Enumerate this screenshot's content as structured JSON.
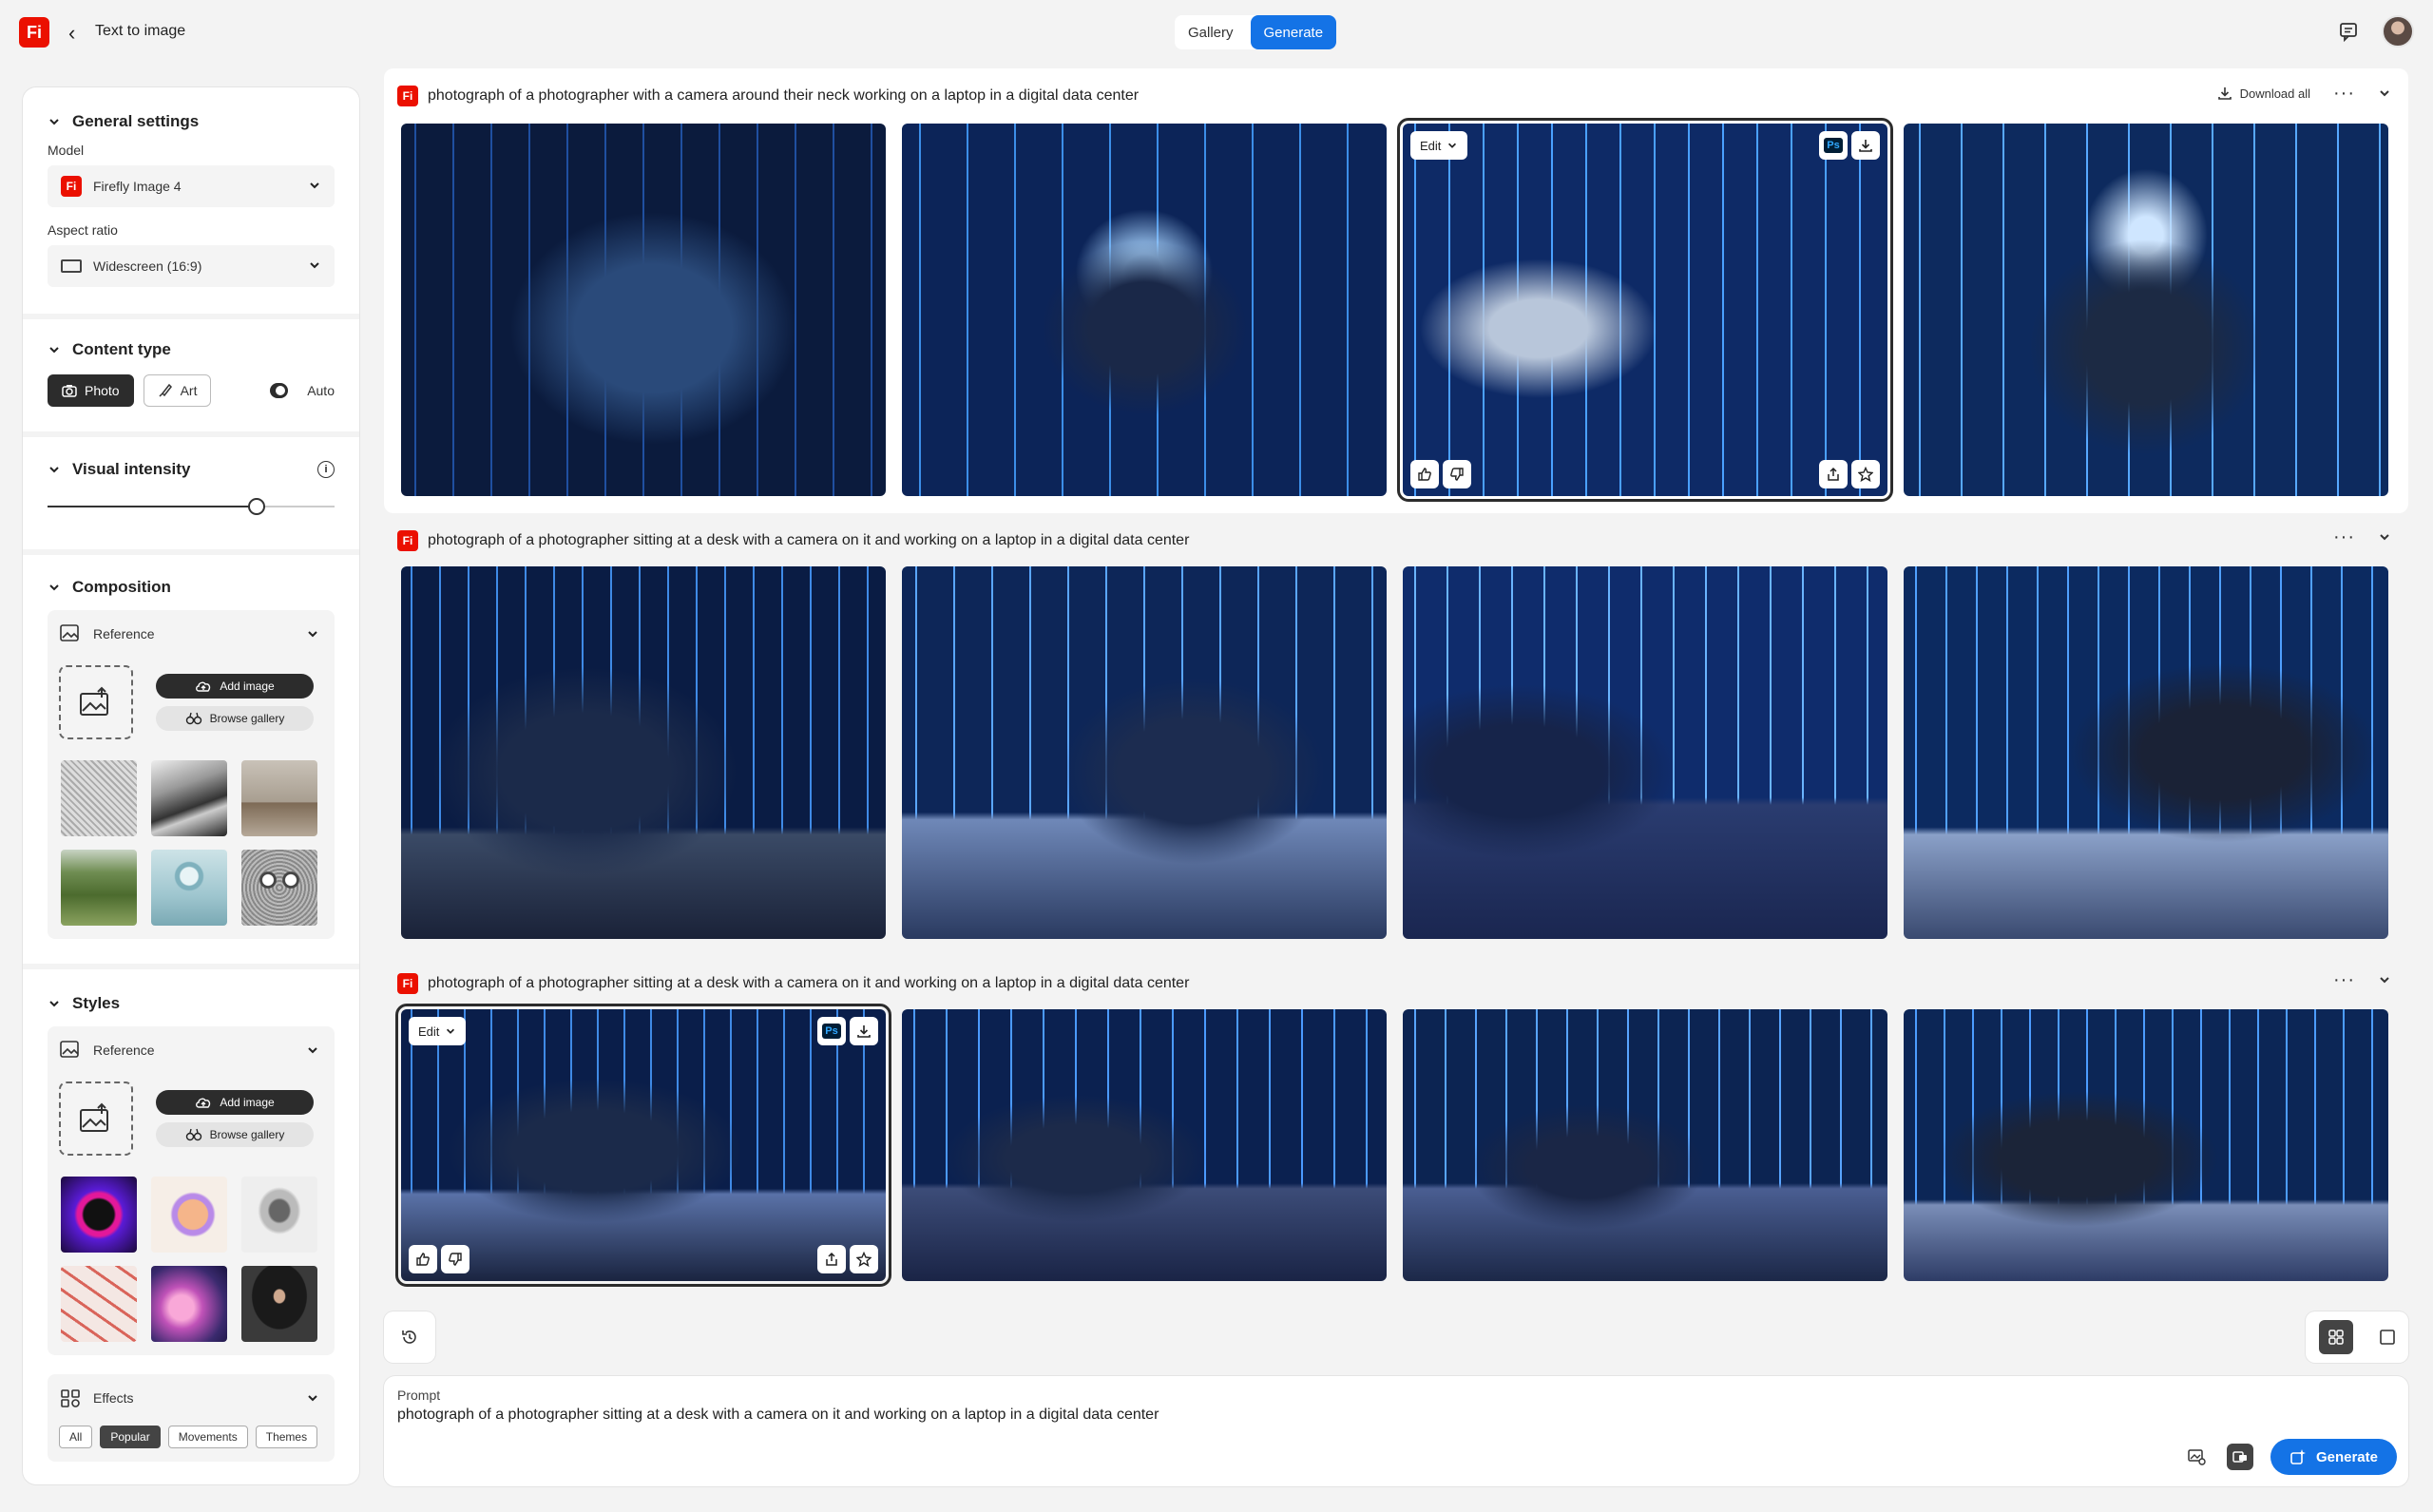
{
  "app": {
    "logo_text": "Fi",
    "title": "Text to image",
    "modes": [
      "Gallery",
      "Generate"
    ],
    "active_mode": "Generate"
  },
  "sidebar": {
    "general": {
      "header": "General settings",
      "model_label": "Model",
      "model_value": "Firefly Image 4",
      "aspect_label": "Aspect ratio",
      "aspect_value": "Widescreen (16:9)"
    },
    "content_type": {
      "header": "Content type",
      "options": [
        "Photo",
        "Art"
      ],
      "selected": "Photo",
      "auto_label": "Auto",
      "auto_on": true
    },
    "visual_intensity": {
      "header": "Visual intensity",
      "value": 0.73
    },
    "composition": {
      "header": "Composition",
      "reference_label": "Reference",
      "add_image": "Add image",
      "browse_gallery": "Browse gallery"
    },
    "styles": {
      "header": "Styles",
      "reference_label": "Reference",
      "add_image": "Add image",
      "browse_gallery": "Browse gallery"
    },
    "effects": {
      "header": "Effects",
      "chips": [
        "All",
        "Popular",
        "Movements",
        "Themes"
      ],
      "selected": "Popular"
    }
  },
  "rows": [
    {
      "prompt": "photograph of a photographer with a camera around their neck working on a laptop in a digital data center",
      "download_all": "Download all",
      "selected_index": 2
    },
    {
      "prompt": "photograph of a photographer sitting at a desk with a camera on it and working on a laptop in a digital data center",
      "selected_index": -1
    },
    {
      "prompt": "photograph of a photographer sitting at a desk with a camera on it and working on a laptop in a digital data center",
      "selected_index": 0
    }
  ],
  "overlay": {
    "edit_label": "Edit",
    "ps_label": "Ps"
  },
  "prompt_box": {
    "label": "Prompt",
    "value": "photograph of a photographer sitting at a desk with a camera on it and working on a laptop in a digital data center",
    "generate_label": "Generate"
  },
  "colors": {
    "accent": "#1473e6",
    "brand": "#eb1000",
    "dark": "#2c2c2c"
  }
}
